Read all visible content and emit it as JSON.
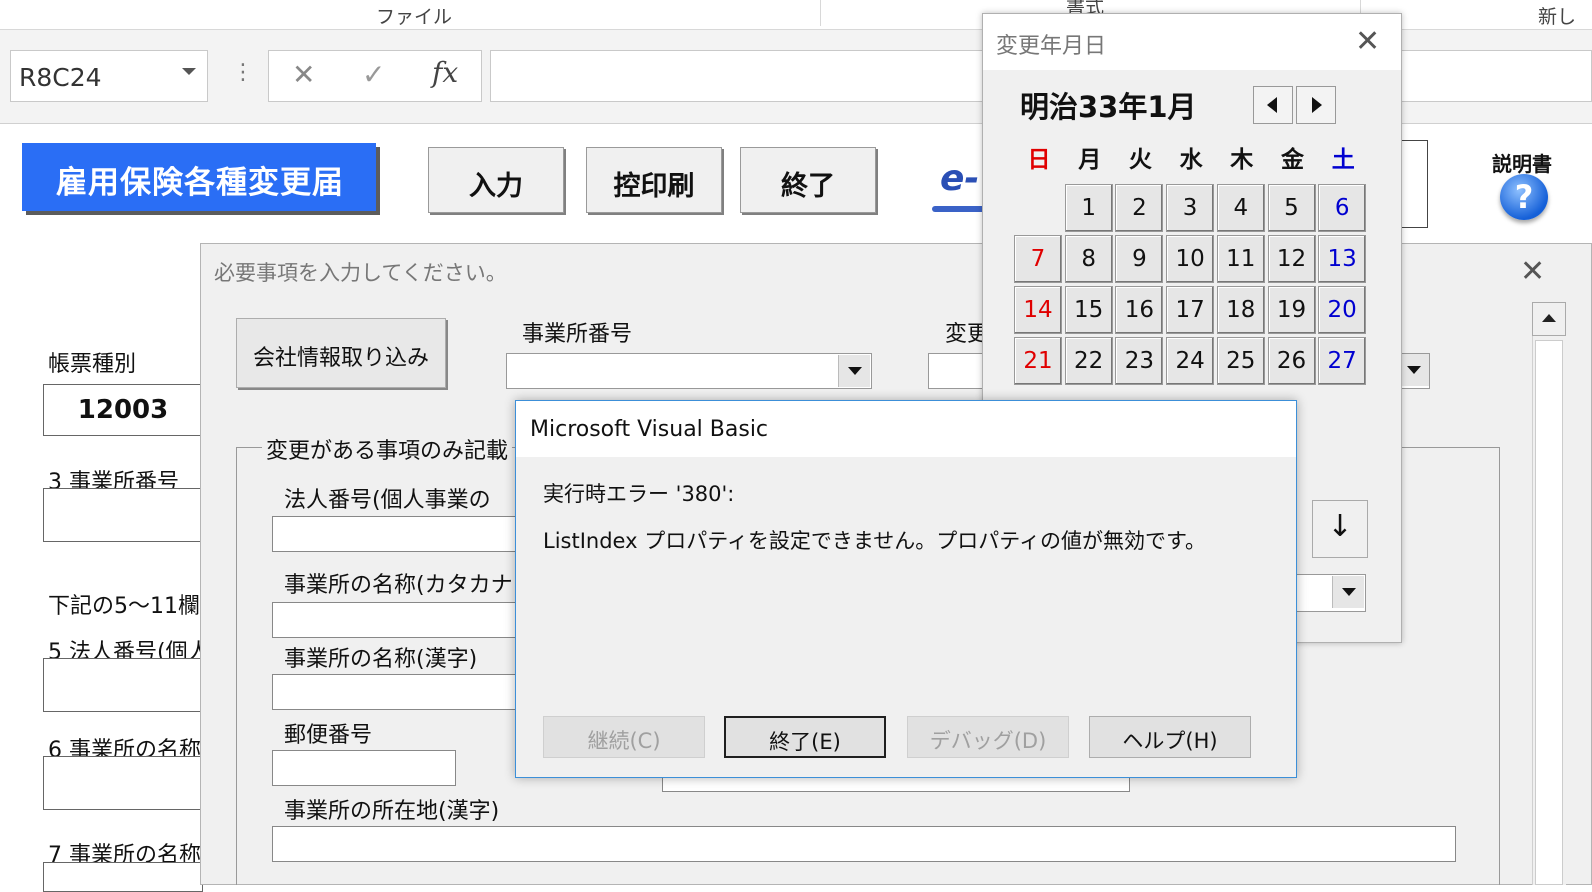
{
  "ribbon": {
    "tab1": "ファイル",
    "tab2": "書式",
    "tab3": "新し"
  },
  "formula_bar": {
    "name_box": "R8C24",
    "cancel_glyph": "✕",
    "enter_glyph": "✓",
    "fx_glyph": "fx",
    "formula": ""
  },
  "sheet": {
    "title_button": "雇用保険各種変更届",
    "buttons": {
      "input": "入力",
      "print": "控印刷",
      "exit": "終了"
    },
    "e_gov_text": "e-",
    "help_label": "説明書",
    "help_glyph": "?",
    "left_labels": {
      "form_type": "帳票種別",
      "form_type_value": "12003",
      "office_no": "3 事業所番号",
      "note": "下記の5～11欄",
      "corp_no": "5 法人番号(個人",
      "office_name6": "6 事業所の名称",
      "office_name7": "7 事業所の名称"
    }
  },
  "input_dialog": {
    "title": "必要事項を入力してください。",
    "import_button": "会社情報取り込み",
    "office_number_label": "事業所番号",
    "change_label": "変更",
    "group_label": "変更がある事項のみ記載",
    "fields": {
      "corp_number": "法人番号(個人事業の",
      "office_name_kana": "事業所の名称(カタカナ",
      "office_name_kanji": "事業所の名称(漢字)",
      "postal_code": "郵便番号",
      "address_kanji": "事業所の所在地(漢字)"
    },
    "down_arrow_glyph": "↓"
  },
  "calendar": {
    "title": "変更年月日",
    "month": "明治33年1月",
    "weekdays": [
      "日",
      "月",
      "火",
      "水",
      "木",
      "金",
      "土"
    ],
    "weekday_colors": [
      "#e00000",
      "#111111",
      "#111111",
      "#111111",
      "#111111",
      "#111111",
      "#0000d0"
    ],
    "rows": [
      [
        "",
        "1",
        "2",
        "3",
        "4",
        "5",
        "6"
      ],
      [
        "7",
        "8",
        "9",
        "10",
        "11",
        "12",
        "13"
      ],
      [
        "14",
        "15",
        "16",
        "17",
        "18",
        "19",
        "20"
      ],
      [
        "21",
        "22",
        "23",
        "24",
        "25",
        "26",
        "27"
      ]
    ]
  },
  "error_dialog": {
    "title": "Microsoft Visual Basic",
    "message1": "実行時エラー '380':",
    "message2": "ListIndex プロパティを設定できません。プロパティの値が無効です。",
    "buttons": {
      "continue": "継続(C)",
      "end": "終了(E)",
      "debug": "デバッグ(D)",
      "help": "ヘルプ(H)"
    }
  }
}
